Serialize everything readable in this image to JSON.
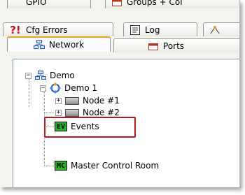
{
  "tabs": {
    "row1": [
      {
        "label": "GPIO"
      },
      {
        "label": "Groups + Col"
      }
    ],
    "row2": [
      {
        "label": "Cfg Errors",
        "icon": "warning-icon"
      },
      {
        "label": "Log",
        "icon": "log-icon"
      }
    ],
    "row3": [
      {
        "label": "Network",
        "icon": "network-icon"
      },
      {
        "label": "Ports",
        "icon": "ports-icon"
      }
    ]
  },
  "tree": {
    "root": {
      "label": "Demo"
    },
    "sub": {
      "label": "Demo 1"
    },
    "nodes": [
      {
        "label": "Node #1"
      },
      {
        "label": "Node #2"
      }
    ],
    "events": {
      "label": "Events",
      "tag": "EV"
    },
    "master": {
      "label": "Master Control Room",
      "tag": "MC"
    }
  },
  "colors": {
    "highlight": "#b31c1c",
    "tag_green": "#1fb81f",
    "active_tab_accent": "#e6a229"
  }
}
